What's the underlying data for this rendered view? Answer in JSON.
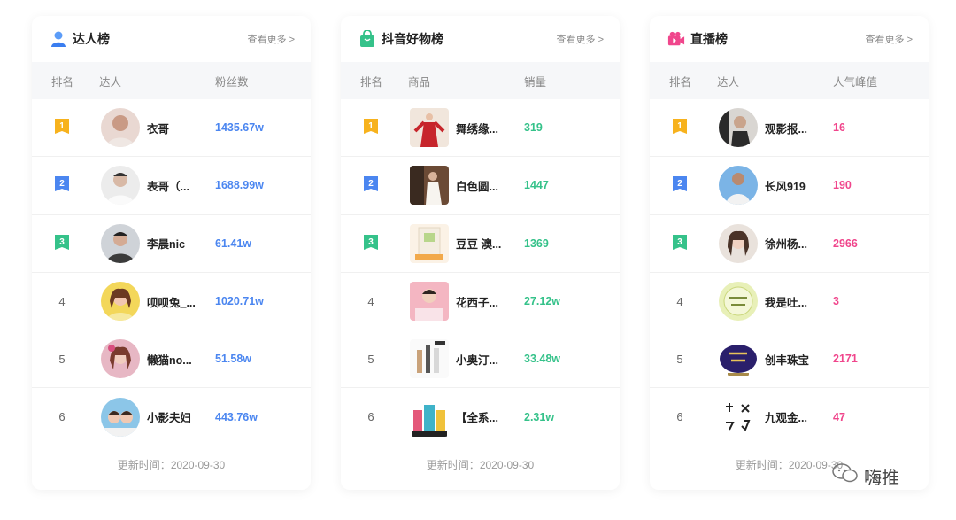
{
  "colors": {
    "gold": "#f7b21d",
    "blue_rank": "#4b86f0",
    "green_rank": "#35c28a",
    "value_blue": "#4b86f0",
    "value_green": "#35c28a",
    "value_pink": "#f0468c"
  },
  "panels": [
    {
      "title": "达人榜",
      "icon": "user-icon",
      "more": "查看更多 >",
      "columns": [
        "排名",
        "达人",
        "粉丝数"
      ],
      "rows": [
        {
          "rank": "1",
          "name": "衣哥",
          "value": "1435.67w"
        },
        {
          "rank": "2",
          "name": "表哥（...",
          "value": "1688.99w"
        },
        {
          "rank": "3",
          "name": "李晨nic",
          "value": "61.41w"
        },
        {
          "rank": "4",
          "name": "呗呗兔_...",
          "value": "1020.71w"
        },
        {
          "rank": "5",
          "name": "懒猫no...",
          "value": "51.58w"
        },
        {
          "rank": "6",
          "name": "小影夫妇",
          "value": "443.76w"
        }
      ],
      "footer_label": "更新时间：",
      "footer_date": "2020-09-30"
    },
    {
      "title": "抖音好物榜",
      "icon": "shopping-bag-icon",
      "more": "查看更多 >",
      "columns": [
        "排名",
        "商品",
        "销量"
      ],
      "rows": [
        {
          "rank": "1",
          "name": "舞绣缘...",
          "value": "319"
        },
        {
          "rank": "2",
          "name": "白色圆...",
          "value": "1447"
        },
        {
          "rank": "3",
          "name": "豆豆 澳...",
          "value": "1369"
        },
        {
          "rank": "4",
          "name": "花西子...",
          "value": "27.12w"
        },
        {
          "rank": "5",
          "name": "小奥汀...",
          "value": "33.48w"
        },
        {
          "rank": "6",
          "name": "【全系...",
          "value": "2.31w"
        }
      ],
      "footer_label": "更新时间：",
      "footer_date": "2020-09-30"
    },
    {
      "title": "直播榜",
      "icon": "live-video-icon",
      "more": "查看更多 >",
      "columns": [
        "排名",
        "达人",
        "人气峰值"
      ],
      "rows": [
        {
          "rank": "1",
          "name": "观影报...",
          "value": "16"
        },
        {
          "rank": "2",
          "name": "长风919",
          "value": "190"
        },
        {
          "rank": "3",
          "name": "徐州杨...",
          "value": "2966"
        },
        {
          "rank": "4",
          "name": "我是吐...",
          "value": "3"
        },
        {
          "rank": "5",
          "name": "创丰珠宝",
          "value": "2171"
        },
        {
          "rank": "6",
          "name": "九观金...",
          "value": "47"
        }
      ],
      "footer_label": "更新时间：",
      "footer_date": "2020-09-30"
    }
  ],
  "watermark": {
    "text": "嗨推"
  }
}
